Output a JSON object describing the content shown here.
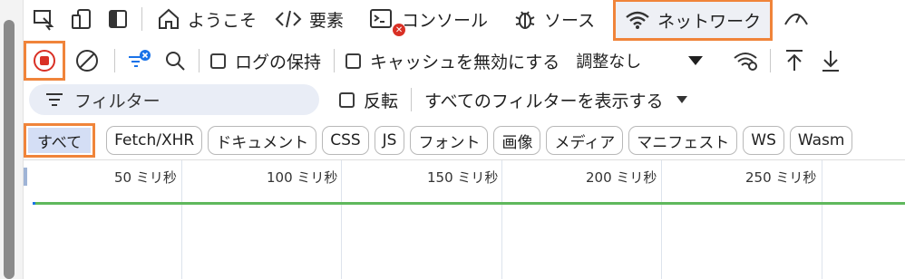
{
  "tabs": [
    {
      "label": "ようこそ",
      "icon": "home-icon"
    },
    {
      "label": "要素",
      "icon": "code-icon"
    },
    {
      "label": "コンソール",
      "icon": "console-icon"
    },
    {
      "label": "ソース",
      "icon": "bug-icon"
    },
    {
      "label": "ネットワーク",
      "icon": "wifi-icon",
      "active": true
    }
  ],
  "toolbar": {
    "preserve_log": "ログの保持",
    "disable_cache": "キャッシュを無効にする",
    "throttling": "調整なし"
  },
  "filter": {
    "placeholder": "フィルター",
    "invert": "反転",
    "show_all": "すべてのフィルターを表示する"
  },
  "types": [
    "すべて",
    "Fetch/XHR",
    "ドキュメント",
    "CSS",
    "JS",
    "フォント",
    "画像",
    "メディア",
    "マニフェスト",
    "WS",
    "Wasm"
  ],
  "timeline": {
    "ticks": [
      "50 ミリ秒",
      "100 ミリ秒",
      "150 ミリ秒",
      "200 ミリ秒",
      "250 ミリ秒"
    ]
  },
  "colors": {
    "highlight": "#f0843a",
    "record": "#d93025",
    "timeline_bar": "#5fb85c",
    "active_chip": "#d4def5"
  }
}
